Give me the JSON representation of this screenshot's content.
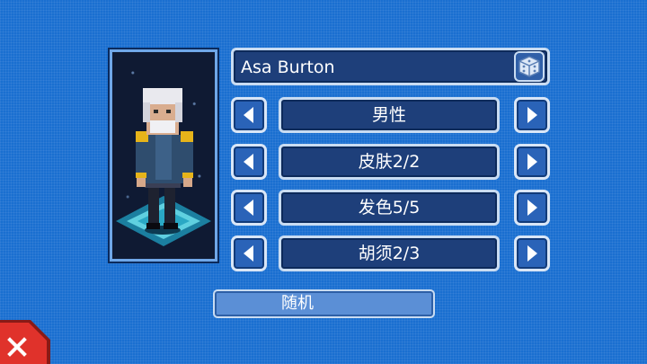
{
  "character": {
    "name": "Asa Burton"
  },
  "options": [
    {
      "key": "gender",
      "value": "男性"
    },
    {
      "key": "skin",
      "value": "皮肤2/2"
    },
    {
      "key": "hair_color",
      "value": "发色5/5"
    },
    {
      "key": "beard",
      "value": "胡须2/3"
    }
  ],
  "buttons": {
    "random_label": "随机"
  },
  "icons": {
    "randomize": "dice-icon",
    "previous": "arrow-left-icon",
    "next": "arrow-right-icon",
    "close": "close-icon"
  },
  "colors": {
    "background": "#1a6fd0",
    "panel": "#1e3f7a",
    "border": "#c9dcf2",
    "close_red": "#e0322b"
  }
}
